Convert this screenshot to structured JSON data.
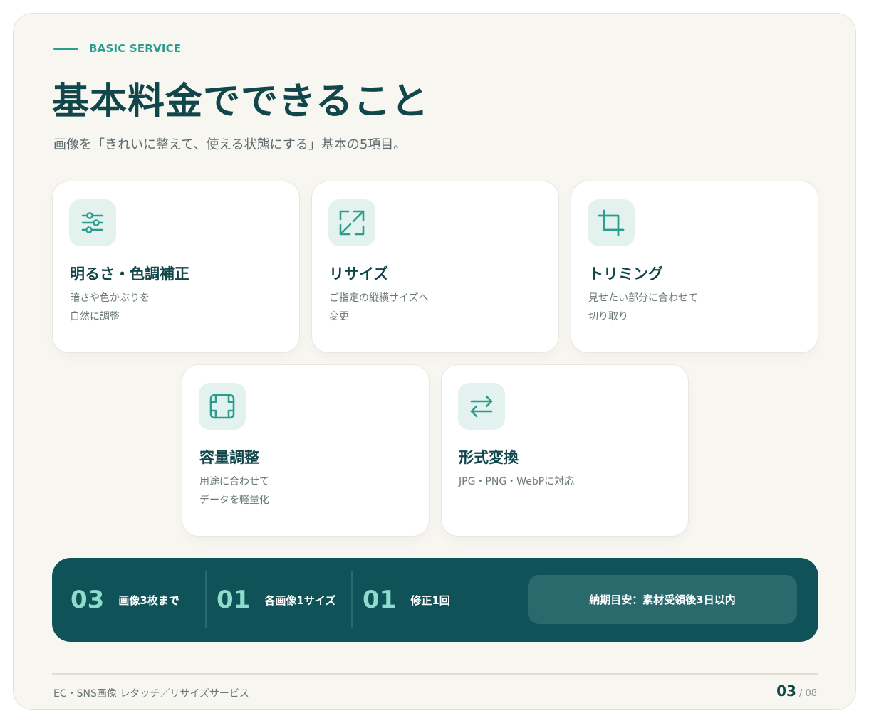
{
  "eyebrow": "BASIC SERVICE",
  "title": "基本料金でできること",
  "subtitle": "画像を「きれいに整えて、使える状態にする」基本の5項目。",
  "cards": [
    {
      "icon": "sliders-icon",
      "title": "明るさ・色調補正",
      "desc": [
        "暗さや色かぶりを",
        "自然に調整"
      ]
    },
    {
      "icon": "expand-arrows-icon",
      "title": "リサイズ",
      "desc": [
        "ご指定の縦横サイズへ",
        "変更"
      ]
    },
    {
      "icon": "crop-icon",
      "title": "トリミング",
      "desc": [
        "見せたい部分に合わせて",
        "切り取り"
      ]
    },
    {
      "icon": "compress-frame-icon",
      "title": "容量調整",
      "desc": [
        "用途に合わせて",
        "データを軽量化"
      ]
    },
    {
      "icon": "swap-arrows-icon",
      "title": "形式変換",
      "desc": [
        "JPG・PNG・WebPに対応"
      ]
    }
  ],
  "stats": [
    {
      "num": "03",
      "label": "画像3枚まで"
    },
    {
      "num": "01",
      "label": "各画像1サイズ"
    },
    {
      "num": "01",
      "label": "修正1回"
    }
  ],
  "note": "納期目安：素材受領後3日以内",
  "footer": {
    "text": "EC・SNS画像 レタッチ／リサイズサービス",
    "page_current": "03",
    "page_total": "/ 08"
  },
  "colors": {
    "accent": "#2a9d8f",
    "primary": "#11464a",
    "band": "#0f5258",
    "stat_number": "#8fdccc",
    "icon_bg": "#e3f2ee",
    "background": "#f8f6f1"
  }
}
